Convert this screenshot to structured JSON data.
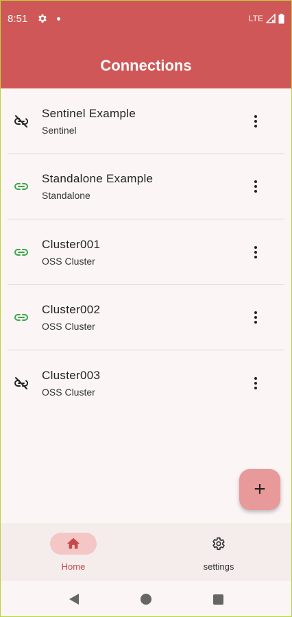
{
  "status_bar": {
    "time": "8:51",
    "network": "LTE"
  },
  "app_bar": {
    "title": "Connections"
  },
  "colors": {
    "accent": "#d05757",
    "connected": "#3aa74a",
    "disconnected": "#222222",
    "fab": "#e89a9a"
  },
  "connections": [
    {
      "name": "Sentinel Example",
      "type": "Sentinel",
      "status": "disconnected",
      "icon": "link-off-icon"
    },
    {
      "name": "Standalone Example",
      "type": "Standalone",
      "status": "connected",
      "icon": "link-icon"
    },
    {
      "name": "Cluster001",
      "type": "OSS Cluster",
      "status": "connected",
      "icon": "link-icon"
    },
    {
      "name": "Cluster002",
      "type": "OSS Cluster",
      "status": "connected",
      "icon": "link-icon"
    },
    {
      "name": "Cluster003",
      "type": "OSS Cluster",
      "status": "disconnected",
      "icon": "link-off-icon"
    }
  ],
  "fab": {
    "label": "+"
  },
  "bottom_nav": {
    "home_label": "Home",
    "settings_label": "settings",
    "active": "Home"
  }
}
